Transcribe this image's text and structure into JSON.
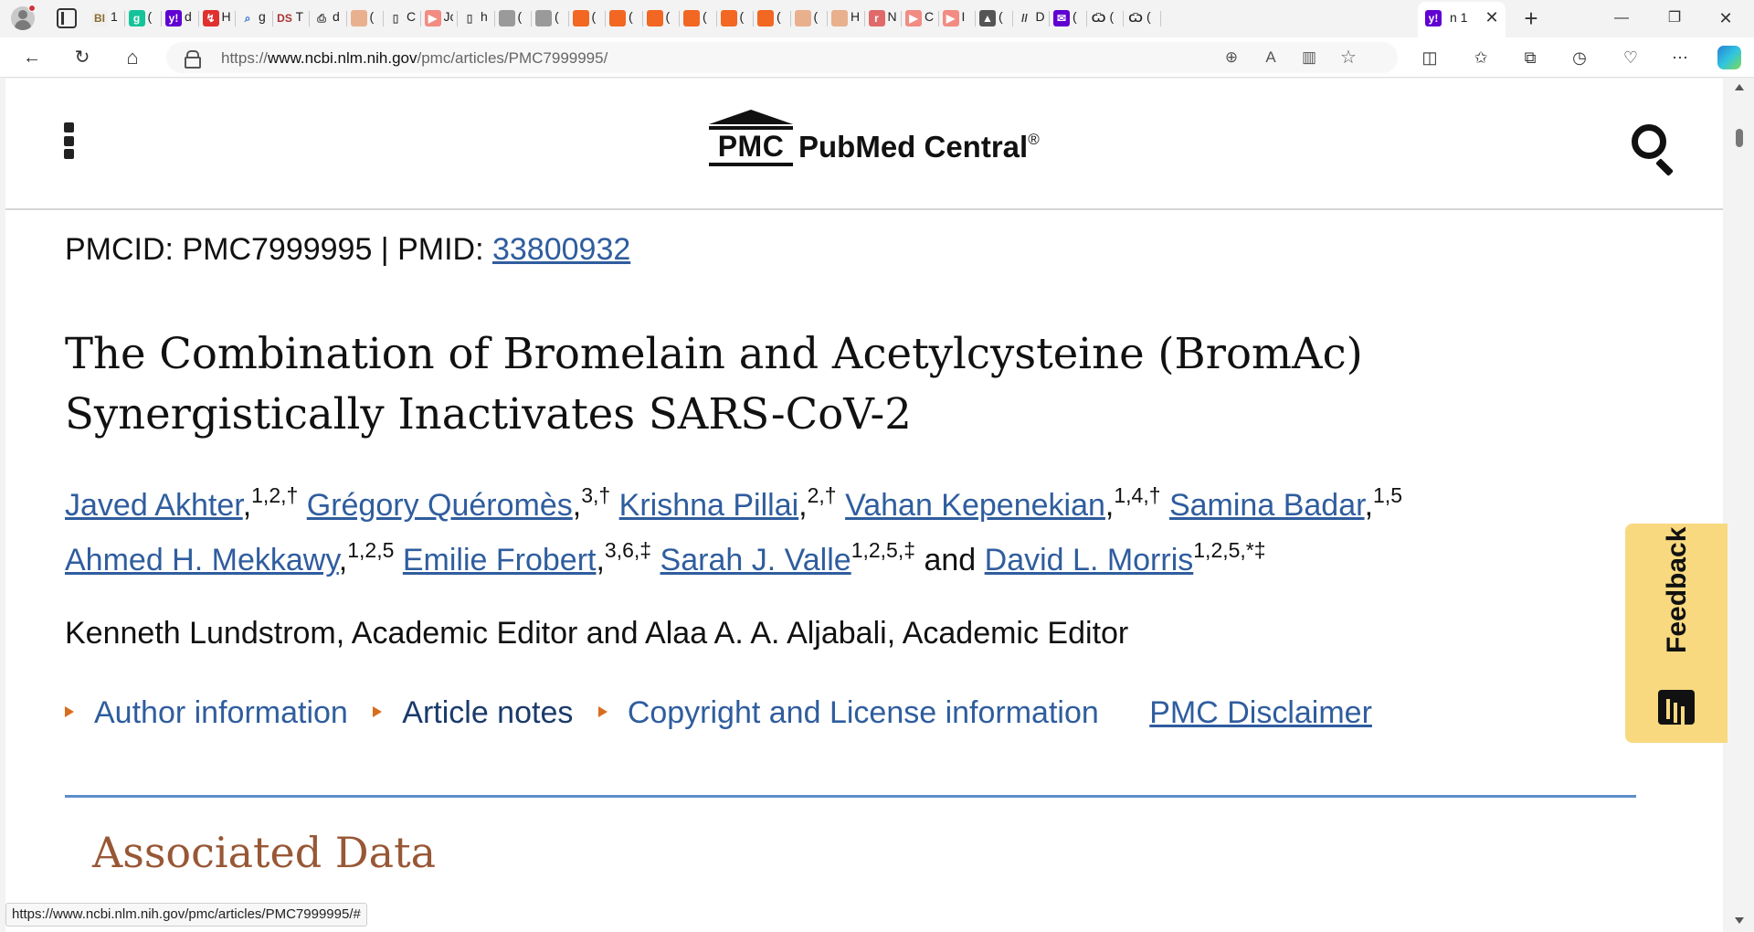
{
  "browser": {
    "tabs": [
      {
        "favicon": "bi-icon",
        "letter": "BI",
        "title": "1",
        "color": "#f0f0f0",
        "fg": "#8a6b2f"
      },
      {
        "favicon": "grammarly-icon",
        "letter": "g",
        "title": "(",
        "color": "#15c39a",
        "fg": "#ffffff"
      },
      {
        "favicon": "yahoo-icon",
        "letter": "y!",
        "title": "d",
        "color": "#6001d2",
        "fg": "#ffffff"
      },
      {
        "favicon": "red-app-icon",
        "letter": "↯",
        "title": "H",
        "color": "#e0312f",
        "fg": "#ffffff"
      },
      {
        "favicon": "search-icon",
        "letter": "⌕",
        "title": "g",
        "color": "#f3f3f3",
        "fg": "#2f6fd0"
      },
      {
        "favicon": "ds-icon",
        "letter": "DS",
        "title": "T",
        "color": "#f3f3f3",
        "fg": "#a33"
      },
      {
        "favicon": "doc-lock-icon",
        "letter": "⎙",
        "title": "d",
        "color": "#f3f3f3",
        "fg": "#444"
      },
      {
        "favicon": "bookmark-tan-icon",
        "letter": "",
        "title": "(",
        "color": "#e9b08e",
        "fg": "#fff"
      },
      {
        "favicon": "page-icon",
        "letter": "▯",
        "title": "C",
        "color": "#f3f3f3",
        "fg": "#555"
      },
      {
        "favicon": "youtube-icon",
        "letter": "▶",
        "title": "Jc",
        "color": "#f28b82",
        "fg": "#fff"
      },
      {
        "favicon": "page-icon",
        "letter": "▯",
        "title": "h",
        "color": "#f3f3f3",
        "fg": "#555"
      },
      {
        "favicon": "image-icon",
        "letter": "",
        "title": "(",
        "color": "#9a9a9a",
        "fg": "#fff"
      },
      {
        "favicon": "image-icon",
        "letter": "",
        "title": "(",
        "color": "#9a9a9a",
        "fg": "#fff"
      },
      {
        "favicon": "bookmark-orange-icon",
        "letter": "",
        "title": "(",
        "color": "#f26722",
        "fg": "#fff"
      },
      {
        "favicon": "bookmark-orange-icon",
        "letter": "",
        "title": "(",
        "color": "#f26722",
        "fg": "#fff"
      },
      {
        "favicon": "bookmark-orange-icon",
        "letter": "",
        "title": "(",
        "color": "#f26722",
        "fg": "#fff"
      },
      {
        "favicon": "bookmark-orange-icon",
        "letter": "",
        "title": "(",
        "color": "#f26722",
        "fg": "#fff"
      },
      {
        "favicon": "bookmark-orange-icon",
        "letter": "",
        "title": "(",
        "color": "#f26722",
        "fg": "#fff"
      },
      {
        "favicon": "bookmark-orange-icon",
        "letter": "",
        "title": "(",
        "color": "#f26722",
        "fg": "#fff"
      },
      {
        "favicon": "bookmark-tan-icon",
        "letter": "",
        "title": "(",
        "color": "#e9b08e",
        "fg": "#fff"
      },
      {
        "favicon": "bookmark-tan-icon",
        "letter": "",
        "title": "H",
        "color": "#e9b08e",
        "fg": "#fff"
      },
      {
        "favicon": "r-icon",
        "letter": "r",
        "title": "N",
        "color": "#e06a6a",
        "fg": "#fff"
      },
      {
        "favicon": "youtube-icon",
        "letter": "▶",
        "title": "C",
        "color": "#f28b82",
        "fg": "#fff"
      },
      {
        "favicon": "youtube-icon",
        "letter": "▶",
        "title": "I",
        "color": "#f28b82",
        "fg": "#fff"
      },
      {
        "favicon": "photo-icon",
        "letter": "▲",
        "title": "(",
        "color": "#555",
        "fg": "#fff"
      },
      {
        "favicon": "dark-logo-icon",
        "letter": "//",
        "title": "D",
        "color": "#f3f3f3",
        "fg": "#333"
      },
      {
        "favicon": "mail-icon",
        "letter": "✉",
        "title": "(",
        "color": "#6001d2",
        "fg": "#fff"
      },
      {
        "favicon": "omega-icon",
        "letter": "Ѿ",
        "title": "(",
        "color": "#f3f3f3",
        "fg": "#222"
      },
      {
        "favicon": "omega-icon",
        "letter": "Ѿ",
        "title": "(",
        "color": "#f3f3f3",
        "fg": "#222"
      }
    ],
    "active_tab": {
      "favicon": "yahoo-icon",
      "letter": "y!",
      "title": "n 1",
      "close": "✕"
    },
    "new_tab": "+",
    "window": {
      "minimize": "—",
      "restore": "❐",
      "close": "✕"
    },
    "nav": {
      "back": "←",
      "refresh": "↻",
      "home": "⌂"
    },
    "url": {
      "prefix": "https://",
      "host": "www.ncbi.nlm.nih.gov",
      "path": "/pmc/articles/PMC7999995/"
    },
    "url_icons": {
      "zoom": "⊕",
      "read_aloud": "A",
      "immersive": "▥",
      "favorite": "☆"
    },
    "toolbar_icons": {
      "split": "◫",
      "favorites": "✩",
      "collections": "⧉",
      "history": "◷",
      "health": "♡",
      "more": "⋯"
    }
  },
  "header": {
    "logo_abbr": "PMC",
    "logo_name": "PubMed Central",
    "logo_mark": "®"
  },
  "article": {
    "pmcid_label": "PMCID: PMC7999995 | PMID: ",
    "pmid": "33800932",
    "title": "The Combination of Bromelain and Acetylcysteine (BromAc) Synergistically Inactivates SARS-CoV-2",
    "authors": [
      {
        "name": "Javed Akhter",
        "sup": "1,2,†",
        "sep": ", "
      },
      {
        "name": "Grégory Quéromès",
        "sup": "3,†",
        "sep": ", "
      },
      {
        "name": "Krishna Pillai",
        "sup": "2,†",
        "sep": ", "
      },
      {
        "name": "Vahan Kepenekian",
        "sup": "1,4,†",
        "sep": ", "
      },
      {
        "name": "Samina Badar",
        "sup": "1,5",
        "sep": ", "
      },
      {
        "name": "Ahmed H. Mekkawy",
        "sup": "1,2,5",
        "sep": ", "
      },
      {
        "name": "Emilie Frobert",
        "sup": "3,6,‡",
        "sep": ", "
      },
      {
        "name": "Sarah J. Valle",
        "sup": "1,2,5,‡",
        "sep": " and "
      },
      {
        "name": "David L. Morris",
        "sup": "1,2,5,*‡",
        "sep": ""
      }
    ],
    "editors": "Kenneth Lundstrom, Academic Editor and Alaa A. A. Aljabali, Academic Editor",
    "info_links": {
      "author_info": "Author information",
      "article_notes": "Article notes",
      "copyright": "Copyright and License information",
      "disclaimer": "PMC Disclaimer"
    },
    "section_heading": "Associated Data"
  },
  "feedback": {
    "label": "Feedback"
  },
  "status_bar": "https://www.ncbi.nlm.nih.gov/pmc/articles/PMC7999995/#"
}
